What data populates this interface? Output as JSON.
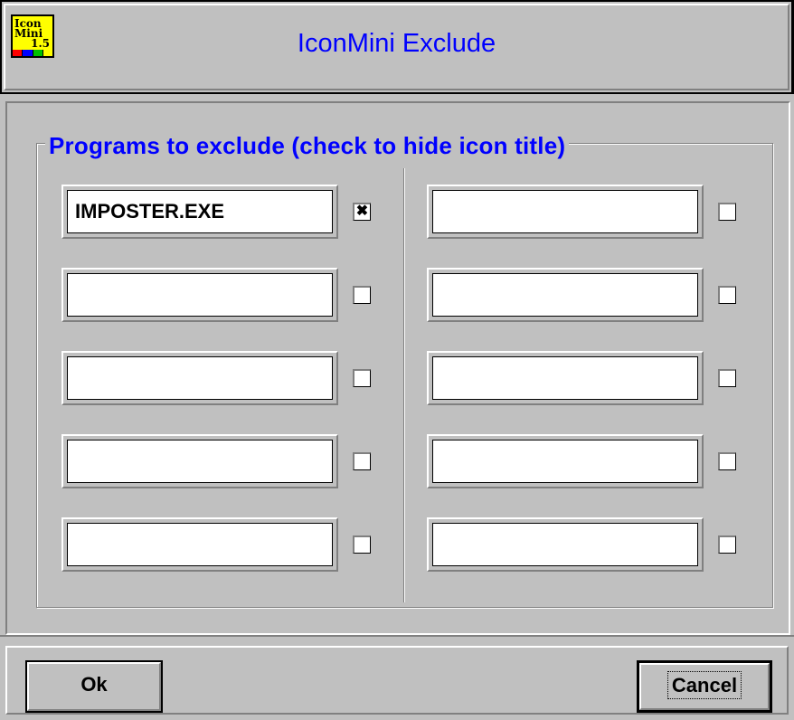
{
  "window": {
    "title": "IconMini Exclude",
    "icon": {
      "name": "iconmini-logo",
      "line1": "Icon",
      "line2": "Mini",
      "line3": "1.5",
      "bar_colors": [
        "#ff0000",
        "#0000ff",
        "#00c000",
        "#ffff00"
      ]
    }
  },
  "group": {
    "label": "Programs to exclude (check to hide icon title)"
  },
  "left_entries": [
    {
      "value": "IMPOSTER.EXE",
      "checked": true
    },
    {
      "value": "",
      "checked": false
    },
    {
      "value": "",
      "checked": false
    },
    {
      "value": "",
      "checked": false
    },
    {
      "value": "",
      "checked": false
    }
  ],
  "right_entries": [
    {
      "value": "",
      "checked": false
    },
    {
      "value": "",
      "checked": false
    },
    {
      "value": "",
      "checked": false
    },
    {
      "value": "",
      "checked": false
    },
    {
      "value": "",
      "checked": false
    }
  ],
  "buttons": {
    "ok_label": "Ok",
    "cancel_label": "Cancel"
  },
  "colors": {
    "accent": "#0000ff",
    "face": "#c0c0c0"
  }
}
